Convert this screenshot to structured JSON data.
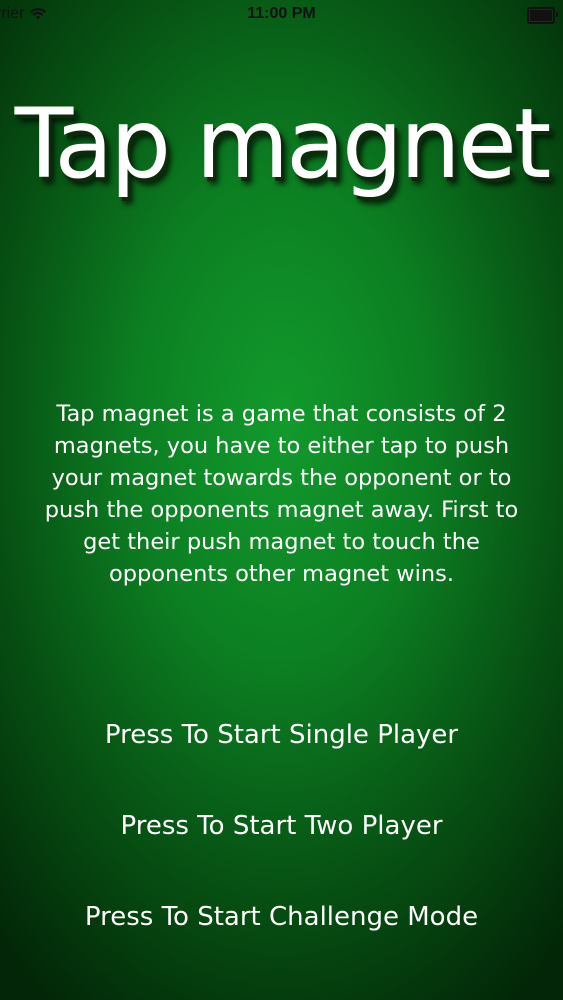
{
  "status_bar": {
    "carrier": "rrier",
    "time": "11:00 PM",
    "wifi_icon": "wifi-icon",
    "battery_icon": "battery-icon",
    "battery_level": 1.0
  },
  "title": "Tap magnet",
  "description": "Tap magnet is a game that consists of 2 magnets, you have to either tap to push your magnet towards the opponent or to push the opponents magnet away. First to get their push magnet to touch the opponents other magnet wins.",
  "menu": {
    "single_player_label": "Press To Start Single Player",
    "two_player_label": "Press To Start Two Player",
    "challenge_mode_label": "Press To Start Challenge Mode"
  },
  "colors": {
    "background_center": "#129a2c",
    "background_edge": "#022607",
    "text": "#ffffff"
  }
}
